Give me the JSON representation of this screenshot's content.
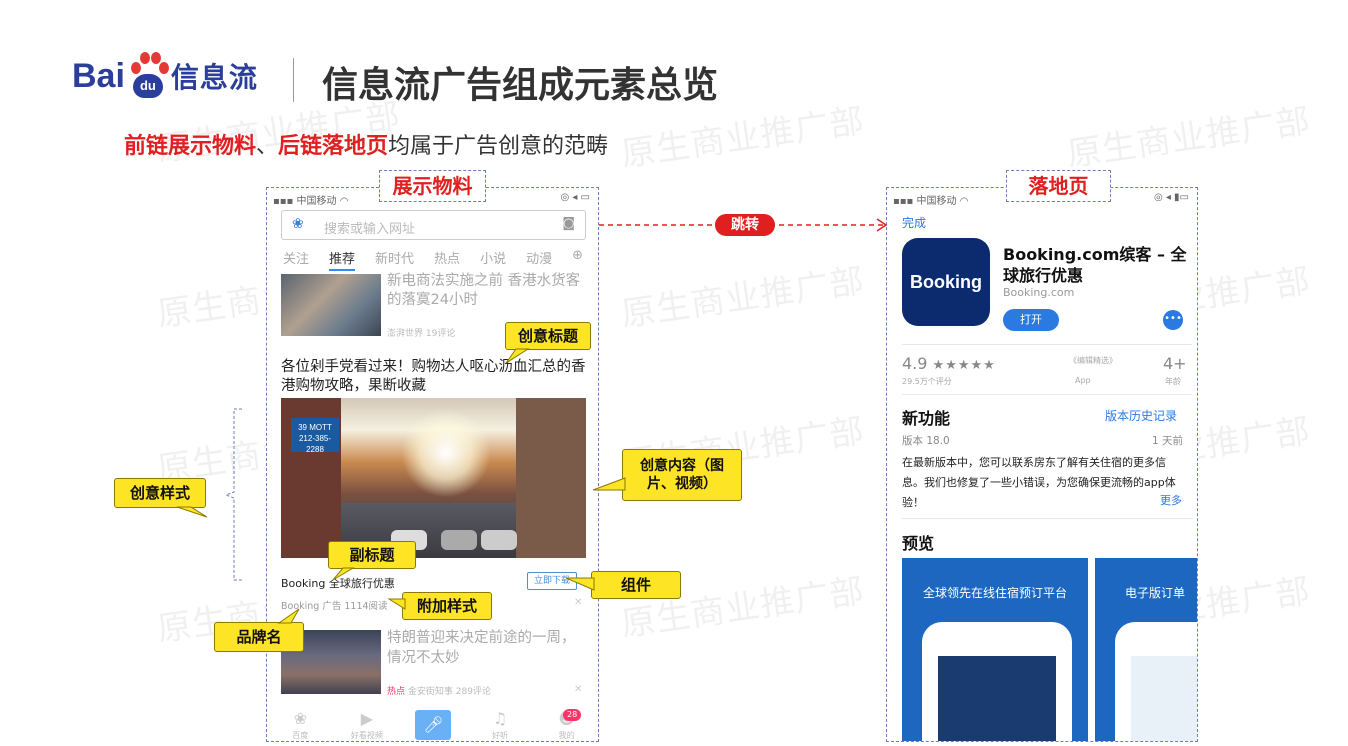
{
  "logo": {
    "latin": "Bai",
    "paw_text": "du",
    "chinese": "信息流"
  },
  "slide_title": "信息流广告组成元素总览",
  "subtitle": {
    "part1": "前链展示物料",
    "sep": "、",
    "part2": "后链落地页",
    "rest": "均属于广告创意的范畴"
  },
  "watermark": "原生商业推广部",
  "tags": {
    "display": "展示物料",
    "landing": "落地页",
    "jump": "跳转"
  },
  "callouts": {
    "creative_title": "创意标题",
    "creative_content": "创意内容（图片、视频）",
    "subtitle": "副标题",
    "component": "组件",
    "extra_style": "附加样式",
    "brand_name": "品牌名",
    "creative_style": "创意样式"
  },
  "feed": {
    "status_left": "中国移动",
    "search_placeholder": "搜索或输入网址",
    "tabs": [
      "关注",
      "推荐",
      "新时代",
      "热点",
      "小说",
      "动漫"
    ],
    "news1": {
      "title": "新电商法实施之前 香港水货客的落寞24小时",
      "meta": "澎湃世界  19评论"
    },
    "ad": {
      "title": "各位剁手党看过来！购物达人呕心沥血汇总的香港购物攻略，果断收藏",
      "image_sign": "39 MOTT 212-385-2288",
      "subtitle": "Booking 全球旅行优惠",
      "cta": "立即下载",
      "brand": "Booking  广告  1114阅读"
    },
    "news2": {
      "title": "特朗普迎来决定前途的一周，情况不太妙",
      "meta_tag": "热点",
      "meta": "金安街知事  289评论"
    },
    "nav": [
      "百度",
      "好看视频",
      "",
      "好听",
      "我的"
    ],
    "badge": "28"
  },
  "landing": {
    "status_left": "中国移动",
    "done": "完成",
    "app_icon_text": "Booking",
    "app_name": "Booking.com缤客 – 全球旅行优惠",
    "developer": "Booking.com",
    "open": "打开",
    "more_dots": "•••",
    "rating": "4.9",
    "stars": "★★★★★",
    "rating_count": "29.5万个评分",
    "editors": "《编辑精选》",
    "app_label": "App",
    "age": "4+",
    "age_label": "年龄",
    "whats_new": "新功能",
    "version_history": "版本历史记录",
    "version": "版本 18.0",
    "ago": "1 天前",
    "release_notes": "在最新版本中，您可以联系房东了解有关住宿的更多信息。我们也修复了一些小错误，为您确保更流畅的app体验！",
    "more": "更多",
    "preview": "预览",
    "shots": [
      "全球领先在线住宿预订平台",
      "电子版订单"
    ]
  },
  "colors": {
    "accent_red": "#e02020",
    "brand_blue": "#2c3e9b",
    "callout_yellow": "#fde425",
    "link_blue": "#2a7ae2"
  }
}
